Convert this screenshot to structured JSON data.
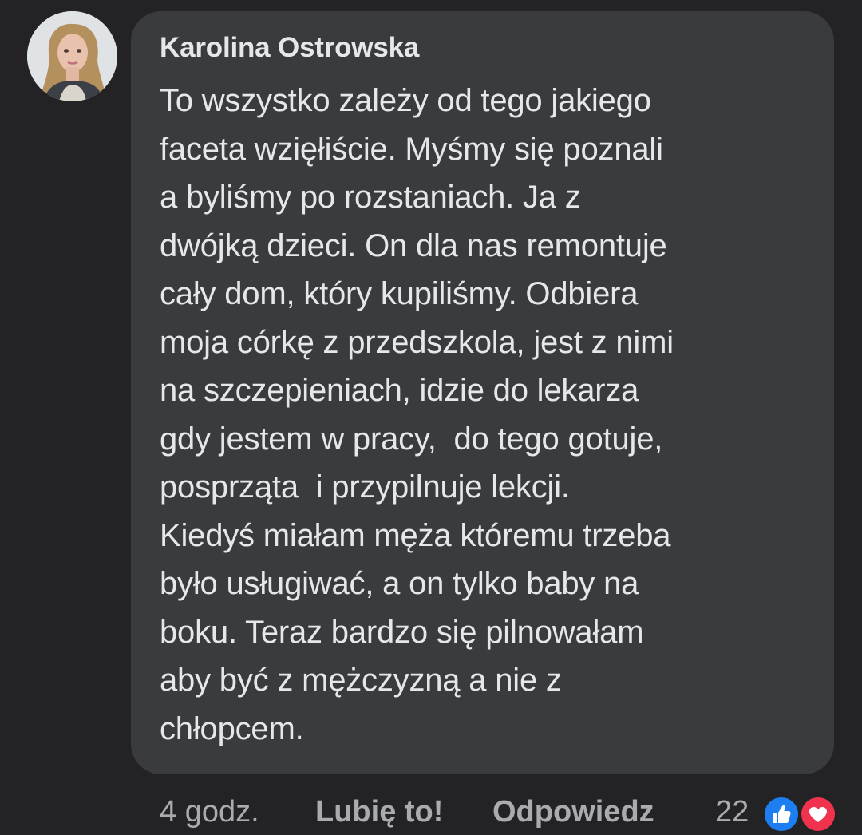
{
  "comment": {
    "author": "Karolina Ostrowska",
    "text": "To wszystko zależy od tego jakiego\nfaceta wzięłiście. Myśmy się poznali\na byliśmy po rozstaniach. Ja z\ndwójką dzieci. On dla nas remontuje\ncały dom, który kupiliśmy. Odbiera\nmoja córkę z przedszkola, jest z nimi\nna szczepieniach, idzie do lekarza\ngdy jestem w pracy,  do tego gotuje,\nposprząta  i przypilnuje lekcji.\nKiedyś miałam męża któremu trzeba\nbyło usługiwać, a on tylko baby na\nboku. Teraz bardzo się pilnowałam\naby być z mężczyzną a nie z\nchłopcem."
  },
  "actions": {
    "time": "4 godz.",
    "like_label": "Lubię to!",
    "reply_label": "Odpowiedz"
  },
  "reactions": {
    "count": "22",
    "types": [
      "like-icon",
      "love-icon"
    ],
    "colors": {
      "like": "#1d7ef2",
      "love": "#f0324f"
    }
  },
  "theme": {
    "background": "#232325",
    "bubble": "#3a3b3d",
    "text": "#e6e7ea",
    "muted": "#a9abaf"
  }
}
